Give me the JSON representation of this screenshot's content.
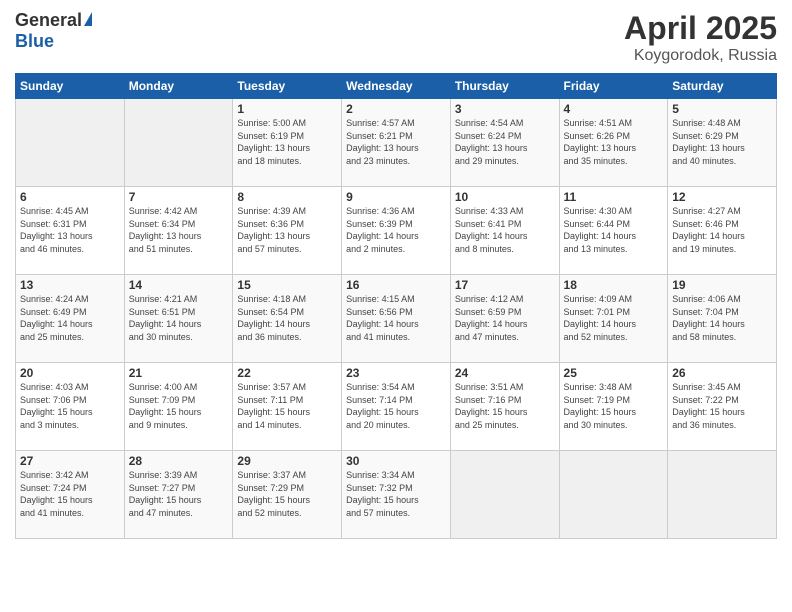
{
  "logo": {
    "general": "General",
    "blue": "Blue"
  },
  "title": "April 2025",
  "subtitle": "Koygorodok, Russia",
  "days_header": [
    "Sunday",
    "Monday",
    "Tuesday",
    "Wednesday",
    "Thursday",
    "Friday",
    "Saturday"
  ],
  "weeks": [
    [
      {
        "day": "",
        "detail": ""
      },
      {
        "day": "",
        "detail": ""
      },
      {
        "day": "1",
        "detail": "Sunrise: 5:00 AM\nSunset: 6:19 PM\nDaylight: 13 hours\nand 18 minutes."
      },
      {
        "day": "2",
        "detail": "Sunrise: 4:57 AM\nSunset: 6:21 PM\nDaylight: 13 hours\nand 23 minutes."
      },
      {
        "day": "3",
        "detail": "Sunrise: 4:54 AM\nSunset: 6:24 PM\nDaylight: 13 hours\nand 29 minutes."
      },
      {
        "day": "4",
        "detail": "Sunrise: 4:51 AM\nSunset: 6:26 PM\nDaylight: 13 hours\nand 35 minutes."
      },
      {
        "day": "5",
        "detail": "Sunrise: 4:48 AM\nSunset: 6:29 PM\nDaylight: 13 hours\nand 40 minutes."
      }
    ],
    [
      {
        "day": "6",
        "detail": "Sunrise: 4:45 AM\nSunset: 6:31 PM\nDaylight: 13 hours\nand 46 minutes."
      },
      {
        "day": "7",
        "detail": "Sunrise: 4:42 AM\nSunset: 6:34 PM\nDaylight: 13 hours\nand 51 minutes."
      },
      {
        "day": "8",
        "detail": "Sunrise: 4:39 AM\nSunset: 6:36 PM\nDaylight: 13 hours\nand 57 minutes."
      },
      {
        "day": "9",
        "detail": "Sunrise: 4:36 AM\nSunset: 6:39 PM\nDaylight: 14 hours\nand 2 minutes."
      },
      {
        "day": "10",
        "detail": "Sunrise: 4:33 AM\nSunset: 6:41 PM\nDaylight: 14 hours\nand 8 minutes."
      },
      {
        "day": "11",
        "detail": "Sunrise: 4:30 AM\nSunset: 6:44 PM\nDaylight: 14 hours\nand 13 minutes."
      },
      {
        "day": "12",
        "detail": "Sunrise: 4:27 AM\nSunset: 6:46 PM\nDaylight: 14 hours\nand 19 minutes."
      }
    ],
    [
      {
        "day": "13",
        "detail": "Sunrise: 4:24 AM\nSunset: 6:49 PM\nDaylight: 14 hours\nand 25 minutes."
      },
      {
        "day": "14",
        "detail": "Sunrise: 4:21 AM\nSunset: 6:51 PM\nDaylight: 14 hours\nand 30 minutes."
      },
      {
        "day": "15",
        "detail": "Sunrise: 4:18 AM\nSunset: 6:54 PM\nDaylight: 14 hours\nand 36 minutes."
      },
      {
        "day": "16",
        "detail": "Sunrise: 4:15 AM\nSunset: 6:56 PM\nDaylight: 14 hours\nand 41 minutes."
      },
      {
        "day": "17",
        "detail": "Sunrise: 4:12 AM\nSunset: 6:59 PM\nDaylight: 14 hours\nand 47 minutes."
      },
      {
        "day": "18",
        "detail": "Sunrise: 4:09 AM\nSunset: 7:01 PM\nDaylight: 14 hours\nand 52 minutes."
      },
      {
        "day": "19",
        "detail": "Sunrise: 4:06 AM\nSunset: 7:04 PM\nDaylight: 14 hours\nand 58 minutes."
      }
    ],
    [
      {
        "day": "20",
        "detail": "Sunrise: 4:03 AM\nSunset: 7:06 PM\nDaylight: 15 hours\nand 3 minutes."
      },
      {
        "day": "21",
        "detail": "Sunrise: 4:00 AM\nSunset: 7:09 PM\nDaylight: 15 hours\nand 9 minutes."
      },
      {
        "day": "22",
        "detail": "Sunrise: 3:57 AM\nSunset: 7:11 PM\nDaylight: 15 hours\nand 14 minutes."
      },
      {
        "day": "23",
        "detail": "Sunrise: 3:54 AM\nSunset: 7:14 PM\nDaylight: 15 hours\nand 20 minutes."
      },
      {
        "day": "24",
        "detail": "Sunrise: 3:51 AM\nSunset: 7:16 PM\nDaylight: 15 hours\nand 25 minutes."
      },
      {
        "day": "25",
        "detail": "Sunrise: 3:48 AM\nSunset: 7:19 PM\nDaylight: 15 hours\nand 30 minutes."
      },
      {
        "day": "26",
        "detail": "Sunrise: 3:45 AM\nSunset: 7:22 PM\nDaylight: 15 hours\nand 36 minutes."
      }
    ],
    [
      {
        "day": "27",
        "detail": "Sunrise: 3:42 AM\nSunset: 7:24 PM\nDaylight: 15 hours\nand 41 minutes."
      },
      {
        "day": "28",
        "detail": "Sunrise: 3:39 AM\nSunset: 7:27 PM\nDaylight: 15 hours\nand 47 minutes."
      },
      {
        "day": "29",
        "detail": "Sunrise: 3:37 AM\nSunset: 7:29 PM\nDaylight: 15 hours\nand 52 minutes."
      },
      {
        "day": "30",
        "detail": "Sunrise: 3:34 AM\nSunset: 7:32 PM\nDaylight: 15 hours\nand 57 minutes."
      },
      {
        "day": "",
        "detail": ""
      },
      {
        "day": "",
        "detail": ""
      },
      {
        "day": "",
        "detail": ""
      }
    ]
  ]
}
